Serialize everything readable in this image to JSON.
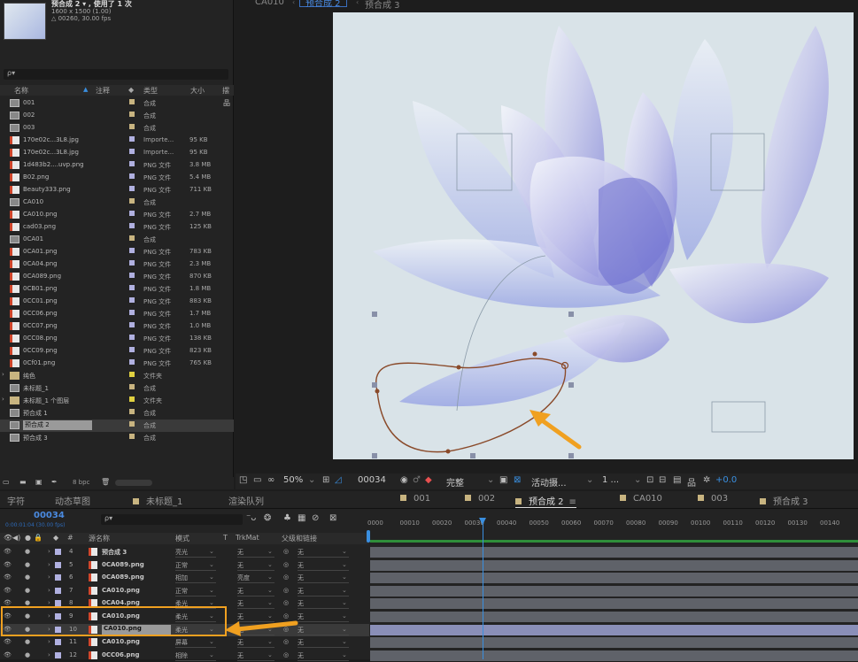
{
  "project": {
    "comp_name": "预合成 2 ▾ , 使用了 1 次",
    "comp_size": "1600 x 1500 (1.00)",
    "comp_duration": "△ 00260, 30.00 fps",
    "search_placeholder": "ρ▾",
    "columns": {
      "name": "名称",
      "comment": "注释",
      "type": "类型",
      "size": "大小",
      "frame": "摆"
    },
    "items": [
      {
        "name": "001",
        "type": "合成",
        "size": "",
        "icon": "comp",
        "color": "#c8b480"
      },
      {
        "name": "002",
        "type": "合成",
        "size": "",
        "icon": "comp",
        "color": "#c8b480"
      },
      {
        "name": "003",
        "type": "合成",
        "size": "",
        "icon": "comp",
        "color": "#c8b480"
      },
      {
        "name": "170e02c...3L8.jpg",
        "type": "Importe...",
        "size": "95 KB",
        "icon": "img",
        "color": "#b0b0e0"
      },
      {
        "name": "170e02c...3L8.jpg",
        "type": "Importe...",
        "size": "95 KB",
        "icon": "img",
        "color": "#b0b0e0"
      },
      {
        "name": "1d483b2....uvp.png",
        "type": "PNG 文件",
        "size": "3.8 MB",
        "icon": "img",
        "color": "#b0b0e0"
      },
      {
        "name": "B02.png",
        "type": "PNG 文件",
        "size": "5.4 MB",
        "icon": "img",
        "color": "#b0b0e0"
      },
      {
        "name": "Beauty333.png",
        "type": "PNG 文件",
        "size": "711 KB",
        "icon": "img",
        "color": "#b0b0e0"
      },
      {
        "name": "CA010",
        "type": "合成",
        "size": "",
        "icon": "comp",
        "color": "#c8b480"
      },
      {
        "name": "CA010.png",
        "type": "PNG 文件",
        "size": "2.7 MB",
        "icon": "img",
        "color": "#b0b0e0"
      },
      {
        "name": "cad03.png",
        "type": "PNG 文件",
        "size": "125 KB",
        "icon": "img",
        "color": "#b0b0e0"
      },
      {
        "name": "0CA01",
        "type": "合成",
        "size": "",
        "icon": "comp",
        "color": "#c8b480"
      },
      {
        "name": "0CA01.png",
        "type": "PNG 文件",
        "size": "783 KB",
        "icon": "img",
        "color": "#b0b0e0"
      },
      {
        "name": "0CA04.png",
        "type": "PNG 文件",
        "size": "2.3 MB",
        "icon": "img",
        "color": "#b0b0e0"
      },
      {
        "name": "0CA089.png",
        "type": "PNG 文件",
        "size": "870 KB",
        "icon": "img",
        "color": "#b0b0e0"
      },
      {
        "name": "0CB01.png",
        "type": "PNG 文件",
        "size": "1.8 MB",
        "icon": "img",
        "color": "#b0b0e0"
      },
      {
        "name": "0CC01.png",
        "type": "PNG 文件",
        "size": "883 KB",
        "icon": "img",
        "color": "#b0b0e0"
      },
      {
        "name": "0CC06.png",
        "type": "PNG 文件",
        "size": "1.7 MB",
        "icon": "img",
        "color": "#b0b0e0"
      },
      {
        "name": "0CC07.png",
        "type": "PNG 文件",
        "size": "1.0 MB",
        "icon": "img",
        "color": "#b0b0e0"
      },
      {
        "name": "0CC08.png",
        "type": "PNG 文件",
        "size": "138 KB",
        "icon": "img",
        "color": "#b0b0e0"
      },
      {
        "name": "0CC09.png",
        "type": "PNG 文件",
        "size": "823 KB",
        "icon": "img",
        "color": "#b0b0e0"
      },
      {
        "name": "0Cf01.png",
        "type": "PNG 文件",
        "size": "765 KB",
        "icon": "img",
        "color": "#b0b0e0"
      },
      {
        "name": "纯色",
        "type": "文件夹",
        "size": "",
        "icon": "folder",
        "color": "#e0d040"
      },
      {
        "name": "未标题_1",
        "type": "合成",
        "size": "",
        "icon": "comp",
        "color": "#c8b480"
      },
      {
        "name": "未标题_1 个图层",
        "type": "文件夹",
        "size": "",
        "icon": "folder",
        "color": "#e0d040"
      },
      {
        "name": "预合成 1",
        "type": "合成",
        "size": "",
        "icon": "comp",
        "color": "#c8b480"
      },
      {
        "name": "预合成 2",
        "type": "合成",
        "size": "",
        "icon": "comp",
        "color": "#c8b480",
        "selected": true
      },
      {
        "name": "预合成 3",
        "type": "合成",
        "size": "",
        "icon": "comp",
        "color": "#c8b480"
      }
    ],
    "bpc": "8 bpc"
  },
  "viewer": {
    "breadcrumb": {
      "a": "CA010",
      "b": "预合成 2",
      "c": "预合成 3"
    },
    "zoom": "50%",
    "timecode": "00034",
    "quality": "完整",
    "camera": "活动摄...",
    "views": "1 ...",
    "exposure": "+0.0"
  },
  "timeline": {
    "tabs": [
      "字符",
      "动态草图",
      "未标题_1",
      "渲染队列",
      "001",
      "002",
      "预合成 2",
      "CA010",
      "003",
      "预合成 3"
    ],
    "timecode": "00034",
    "timecode_sub": "0:00:01:04 (30.00 fps)",
    "search_placeholder": "ρ▾",
    "col_headers": {
      "num": "#",
      "source": "源名称",
      "mode": "模式",
      "t": "T",
      "trkmat": "TrkMat",
      "parent": "父级和链接"
    },
    "ruler": [
      "0000",
      "00010",
      "00020",
      "00030",
      "00040",
      "00050",
      "00060",
      "00070",
      "00080",
      "00090",
      "00100",
      "00110",
      "00120",
      "00130",
      "00140"
    ],
    "layers": [
      {
        "num": "4",
        "name": "预合成 3",
        "mode": "亮光",
        "trk": "无",
        "parent": "无",
        "color": "#b0b0e0"
      },
      {
        "num": "5",
        "name": "0CA089.png",
        "mode": "正常",
        "trk": "无",
        "parent": "无",
        "color": "#b0b0e0"
      },
      {
        "num": "6",
        "name": "0CA089.png",
        "mode": "相加",
        "trk": "亮度",
        "parent": "无",
        "color": "#b0b0e0"
      },
      {
        "num": "7",
        "name": "CA010.png",
        "mode": "正常",
        "trk": "无",
        "parent": "无",
        "color": "#b0b0e0"
      },
      {
        "num": "8",
        "name": "0CA04.png",
        "mode": "柔光",
        "trk": "无",
        "parent": "无",
        "color": "#b0b0e0"
      },
      {
        "num": "9",
        "name": "CA010.png",
        "mode": "柔光",
        "trk": "无",
        "parent": "无",
        "color": "#b0b0e0"
      },
      {
        "num": "10",
        "name": "CA010.png",
        "mode": "柔光",
        "trk": "无",
        "parent": "无",
        "color": "#b0b0e0",
        "selected": true
      },
      {
        "num": "11",
        "name": "CA010.png",
        "mode": "屏幕",
        "trk": "无",
        "parent": "无",
        "color": "#b0b0e0"
      },
      {
        "num": "12",
        "name": "0CC06.png",
        "mode": "相除",
        "trk": "无",
        "parent": "无",
        "color": "#b0b0e0"
      }
    ],
    "accent": "#f0a020"
  }
}
